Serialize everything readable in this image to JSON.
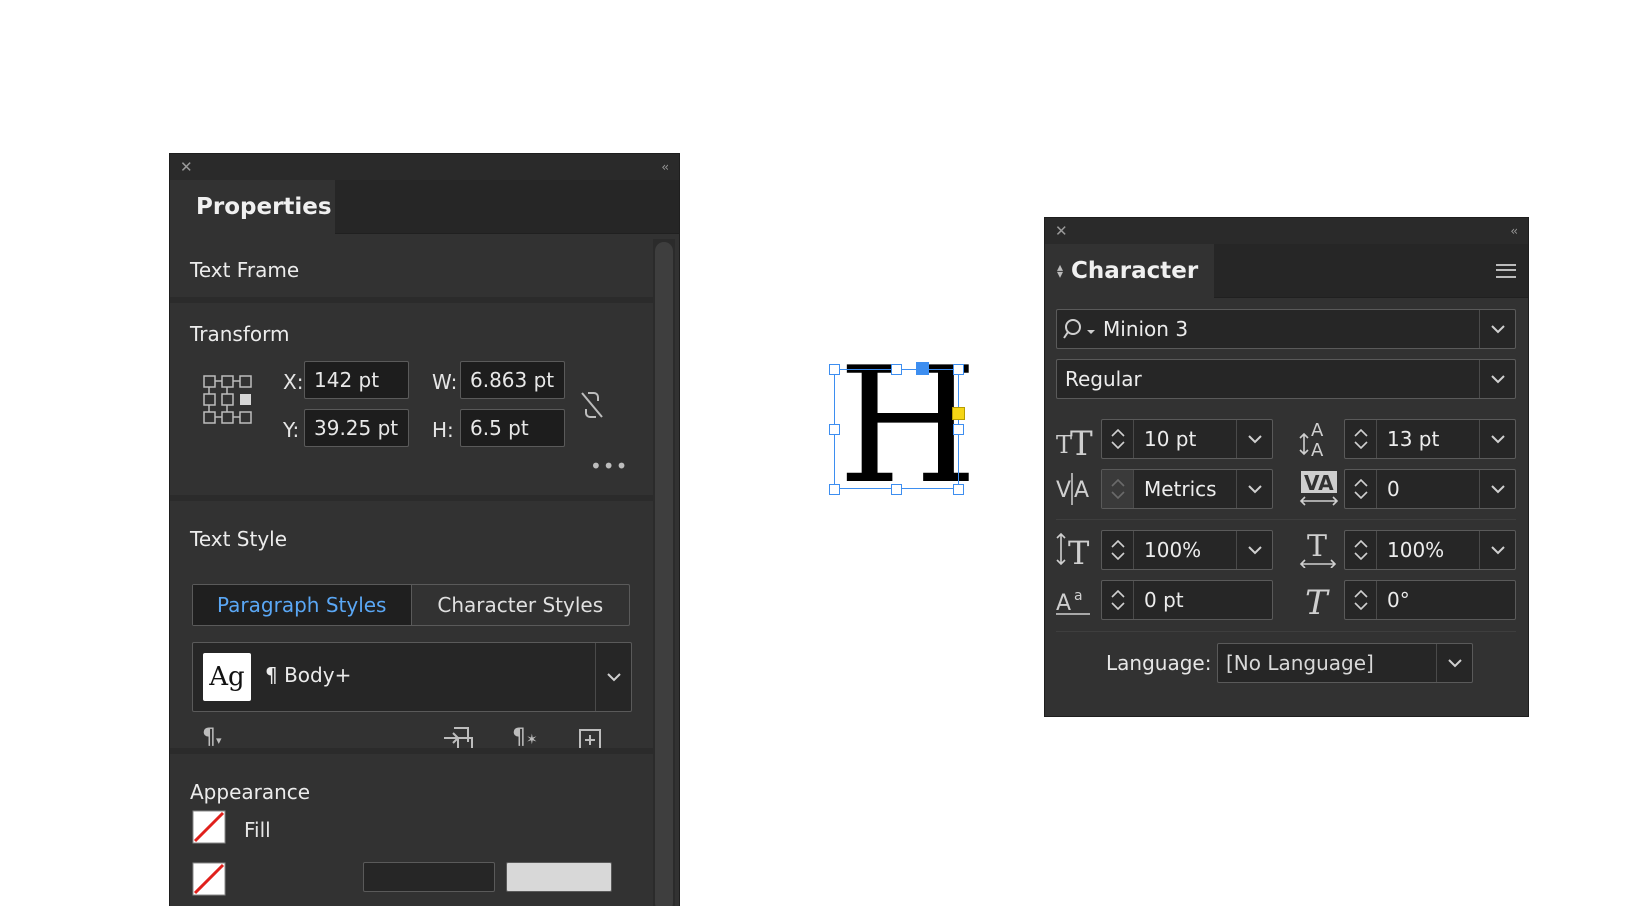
{
  "properties_panel": {
    "tab_title": "Properties",
    "section_text_frame": "Text Frame",
    "transform": {
      "title": "Transform",
      "x_label": "X:",
      "x_value": "142 pt",
      "y_label": "Y:",
      "y_value": "39.25 pt",
      "w_label": "W:",
      "w_value": "6.863 pt",
      "h_label": "H:",
      "h_value": "6.5 pt"
    },
    "text_style": {
      "title": "Text Style",
      "tab_paragraph": "Paragraph Styles",
      "tab_character": "Character Styles",
      "preview_glyph": "Ag",
      "selected_style": "¶ Body+"
    },
    "appearance": {
      "title": "Appearance",
      "fill_label": "Fill"
    }
  },
  "character_panel": {
    "tab_title": "Character",
    "font_family": "Minion 3",
    "font_style": "Regular",
    "font_size": "10 pt",
    "leading": "13 pt",
    "kerning": "Metrics",
    "tracking": "0",
    "vertical_scale": "100%",
    "horizontal_scale": "100%",
    "baseline_shift": "0 pt",
    "skew": "0°",
    "language_label": "Language:",
    "language_value": "[No Language]"
  },
  "canvas": {
    "glyph": "H"
  },
  "colors": {
    "panel_bg": "#323232",
    "accent_blue": "#5aa7f5",
    "selection_blue": "#3d8ef0",
    "handle_yellow": "#f5d515"
  }
}
